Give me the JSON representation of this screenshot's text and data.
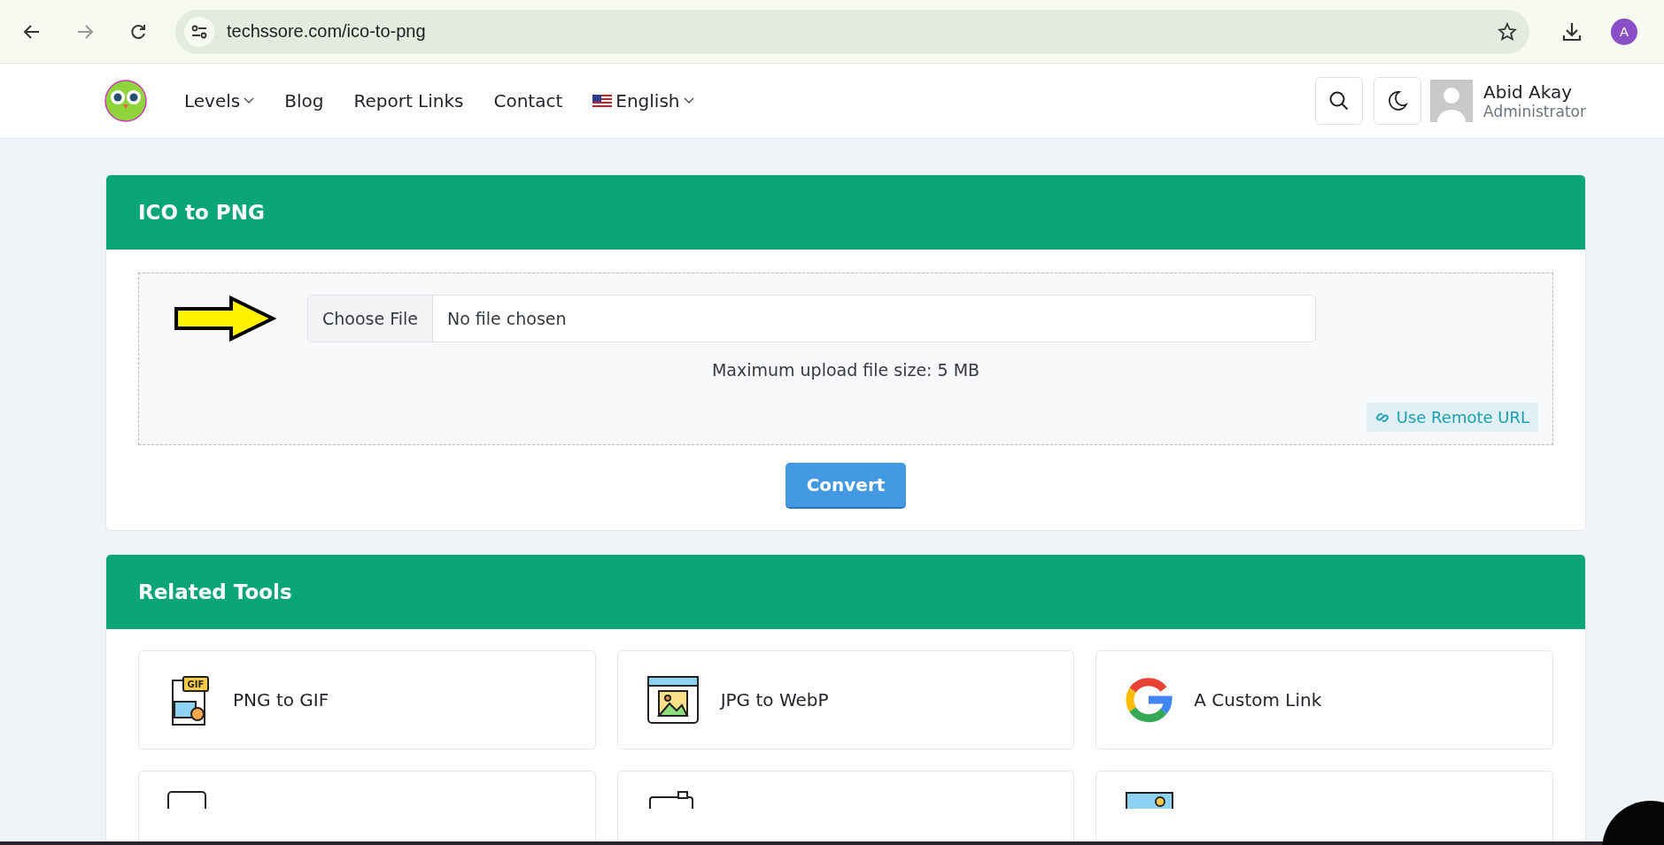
{
  "browser": {
    "url": "techssore.com/ico-to-png",
    "profile_initial": "A"
  },
  "nav": {
    "items": [
      {
        "label": "Levels",
        "dropdown": true,
        "kind": "link"
      },
      {
        "label": "Blog",
        "dropdown": false,
        "kind": "link"
      },
      {
        "label": "Report Links",
        "dropdown": false,
        "kind": "link"
      },
      {
        "label": "Contact",
        "dropdown": false,
        "kind": "link"
      },
      {
        "label": "English",
        "dropdown": true,
        "kind": "language"
      }
    ]
  },
  "user": {
    "name": "Abid Akay",
    "role": "Administrator"
  },
  "converter": {
    "title": "ICO to PNG",
    "choose_button": "Choose File",
    "file_status": "No file chosen",
    "hint": "Maximum upload file size: 5 MB",
    "remote_button": "Use Remote URL",
    "convert_button": "Convert"
  },
  "related": {
    "title": "Related Tools",
    "tools": [
      {
        "label": "PNG to GIF",
        "kind": "gif",
        "badge": "GIF"
      },
      {
        "label": "JPG to WebP",
        "kind": "image"
      },
      {
        "label": "A Custom Link",
        "kind": "google"
      },
      {
        "kind": "screen"
      },
      {
        "kind": "camera"
      },
      {
        "kind": "picture"
      }
    ]
  }
}
